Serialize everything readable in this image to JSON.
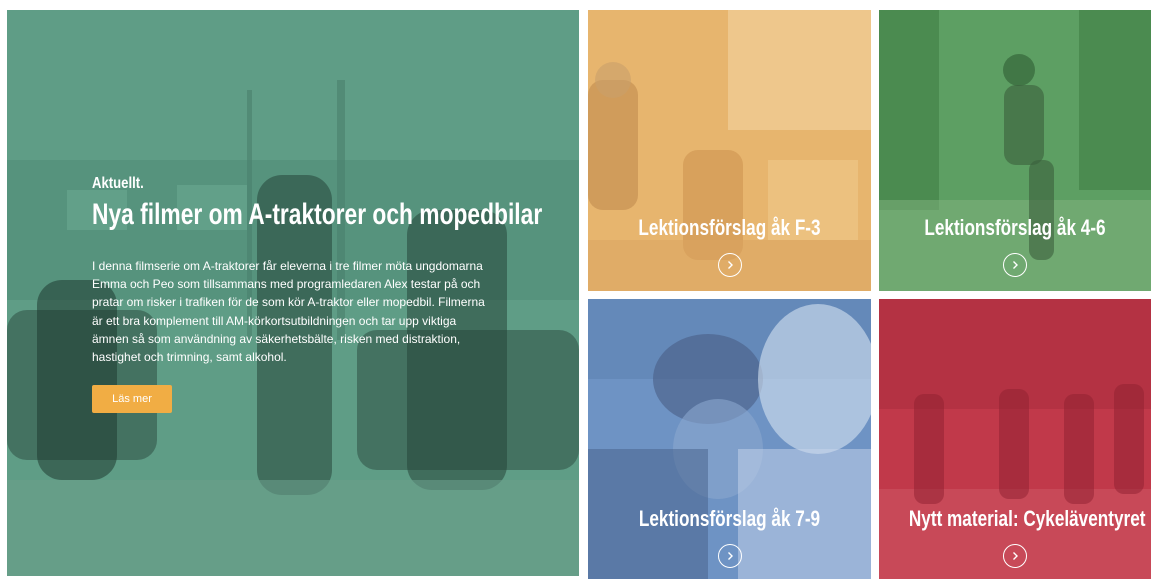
{
  "hero": {
    "kicker": "Aktuellt.",
    "title": "Nya filmer om A-traktorer och mopedbilar",
    "text": "I denna filmserie om A-traktorer får eleverna i tre filmer möta ungdomarna Emma och Peo som tillsammans med programledaren Alex testar på och pratar om risker i trafiken för de som kör A-traktor eller mopedbil. Filmerna är ett bra komplement till AM-körkortsutbildningen och tar upp viktiga ämnen så som användning av säkerhetsbälte, risken med distraktion, hastighet och trimning, samt alkohol.",
    "button_label": "Läs mer",
    "overlay_color": "#5f9d86",
    "button_color": "#f1ad44"
  },
  "tiles": [
    {
      "title": "Lektionsförslag åk F-3",
      "color": "#e7b56e",
      "icon": "chevron-right-circle-icon"
    },
    {
      "title": "Lektionsförslag åk 4-6",
      "color": "#5d9f63",
      "icon": "chevron-right-circle-icon"
    },
    {
      "title": "Lektionsförslag åk 7-9",
      "color": "#6e93c4",
      "icon": "chevron-right-circle-icon"
    },
    {
      "title": "Nytt material: Cykeläventyret",
      "color": "#c1394a",
      "icon": "chevron-right-circle-icon"
    }
  ]
}
